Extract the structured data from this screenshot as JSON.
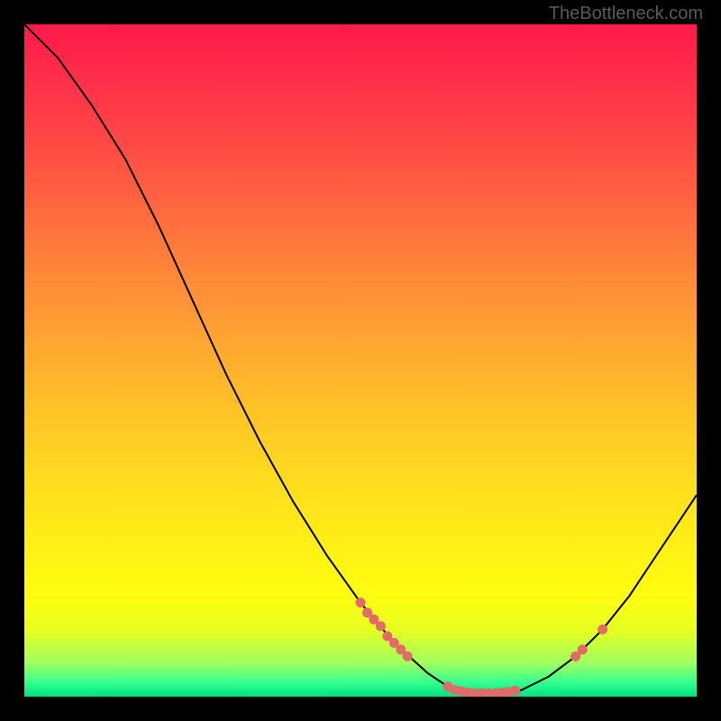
{
  "watermark": "TheBottleneck.com",
  "chart_data": {
    "type": "line",
    "title": "",
    "xlabel": "",
    "ylabel": "",
    "xlim": [
      0,
      100
    ],
    "ylim": [
      0,
      100
    ],
    "curve": [
      {
        "x": 0,
        "y": 100
      },
      {
        "x": 5,
        "y": 95
      },
      {
        "x": 10,
        "y": 88
      },
      {
        "x": 15,
        "y": 80
      },
      {
        "x": 20,
        "y": 70
      },
      {
        "x": 25,
        "y": 59
      },
      {
        "x": 30,
        "y": 48
      },
      {
        "x": 35,
        "y": 38
      },
      {
        "x": 40,
        "y": 29
      },
      {
        "x": 45,
        "y": 21
      },
      {
        "x": 50,
        "y": 14
      },
      {
        "x": 55,
        "y": 8
      },
      {
        "x": 60,
        "y": 3.5
      },
      {
        "x": 63,
        "y": 1.5
      },
      {
        "x": 66,
        "y": 0.5
      },
      {
        "x": 70,
        "y": 0.5
      },
      {
        "x": 74,
        "y": 1
      },
      {
        "x": 78,
        "y": 3
      },
      {
        "x": 82,
        "y": 6
      },
      {
        "x": 86,
        "y": 10
      },
      {
        "x": 90,
        "y": 15
      },
      {
        "x": 94,
        "y": 21
      },
      {
        "x": 98,
        "y": 27
      },
      {
        "x": 100,
        "y": 30
      }
    ],
    "markers": [
      {
        "x": 50,
        "y": 14
      },
      {
        "x": 51,
        "y": 12.5
      },
      {
        "x": 52,
        "y": 11.5
      },
      {
        "x": 53,
        "y": 10.5
      },
      {
        "x": 54,
        "y": 9
      },
      {
        "x": 55,
        "y": 8
      },
      {
        "x": 56,
        "y": 7
      },
      {
        "x": 57,
        "y": 6
      },
      {
        "x": 63,
        "y": 1.5
      },
      {
        "x": 64,
        "y": 1
      },
      {
        "x": 65,
        "y": 0.8
      },
      {
        "x": 66,
        "y": 0.6
      },
      {
        "x": 67,
        "y": 0.5
      },
      {
        "x": 68,
        "y": 0.5
      },
      {
        "x": 69,
        "y": 0.5
      },
      {
        "x": 70,
        "y": 0.5
      },
      {
        "x": 71,
        "y": 0.6
      },
      {
        "x": 72,
        "y": 0.7
      },
      {
        "x": 73,
        "y": 0.9
      },
      {
        "x": 82,
        "y": 6
      },
      {
        "x": 83,
        "y": 7
      },
      {
        "x": 86,
        "y": 10
      }
    ],
    "marker_color": "#e26a68",
    "curve_color": "#000000"
  }
}
